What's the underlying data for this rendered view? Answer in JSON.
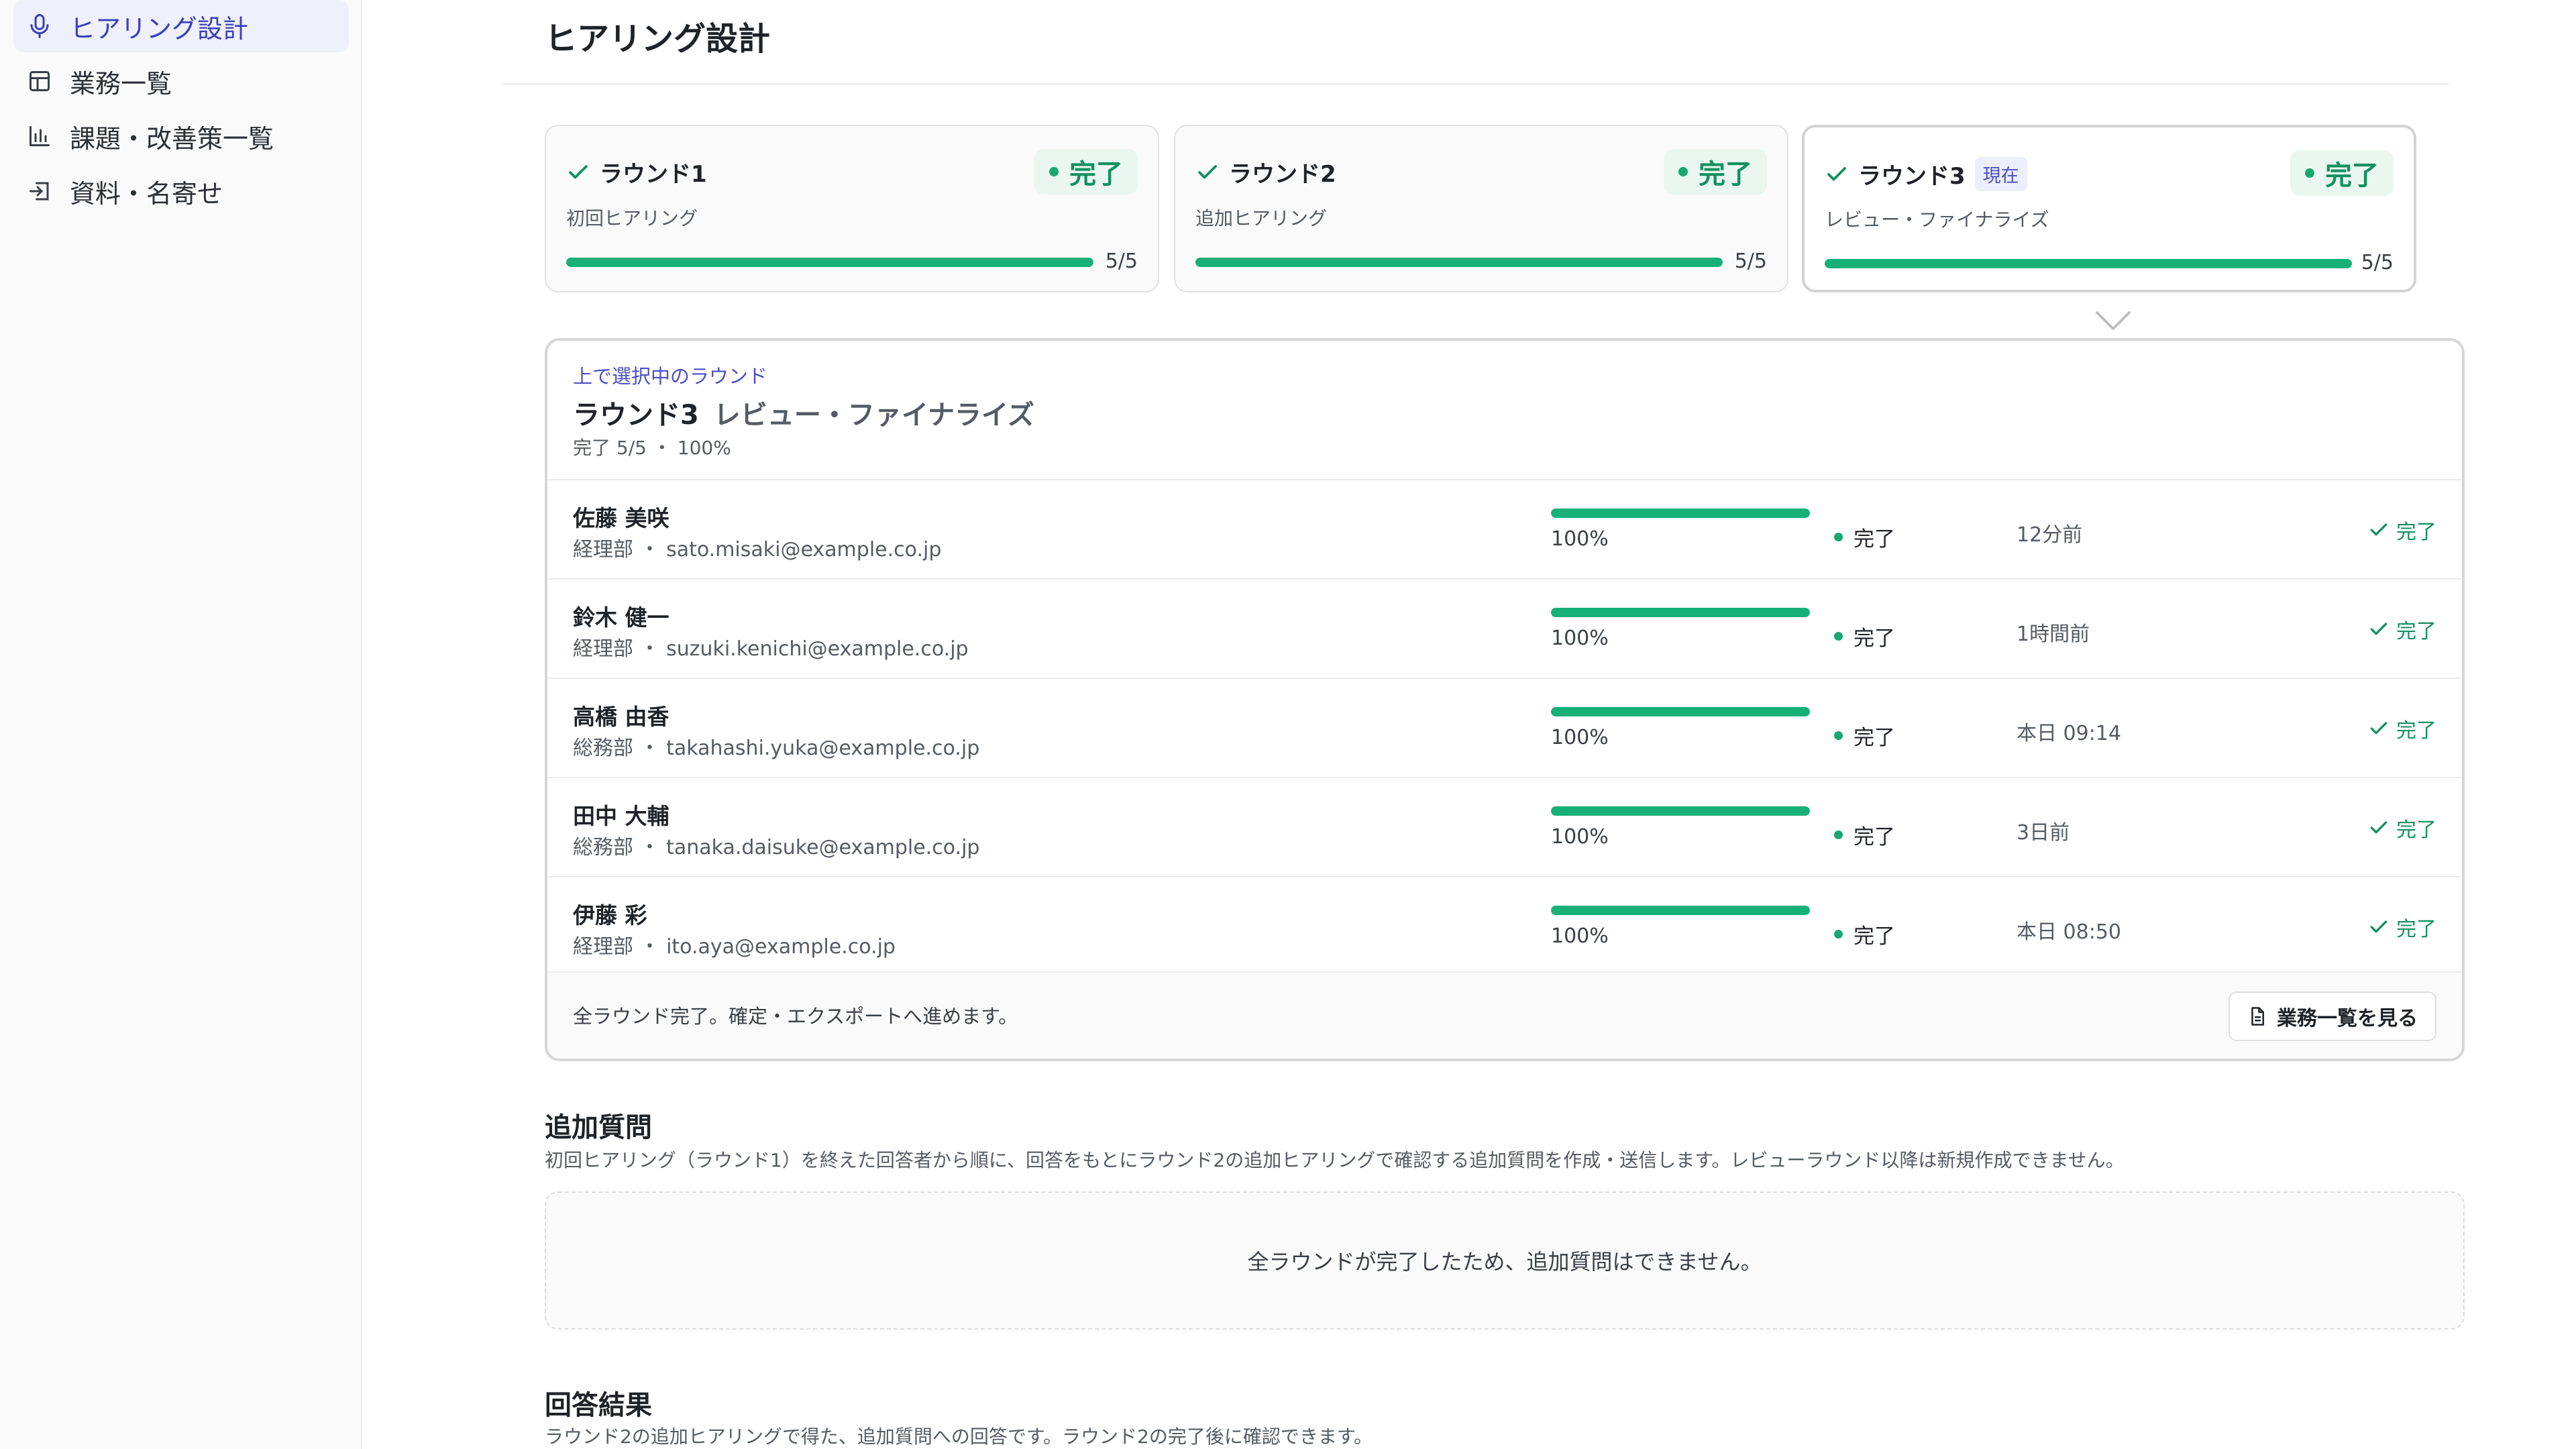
{
  "sidebar": {
    "items": [
      {
        "label": "ヒアリング設計",
        "icon": "microphone-icon",
        "active": true
      },
      {
        "label": "業務一覧",
        "icon": "table-icon",
        "active": false
      },
      {
        "label": "課題・改善策一覧",
        "icon": "bar-chart-icon",
        "active": false
      },
      {
        "label": "資料・名寄せ",
        "icon": "import-icon",
        "active": false
      }
    ]
  },
  "page": {
    "title": "ヒアリング設計"
  },
  "rounds": [
    {
      "label": "ラウンド1",
      "subtitle": "初回ヒアリング",
      "status": "完了",
      "count": "5/5",
      "progress": 1.0,
      "badge": ""
    },
    {
      "label": "ラウンド2",
      "subtitle": "追加ヒアリング",
      "status": "完了",
      "count": "5/5",
      "progress": 1.0,
      "badge": ""
    },
    {
      "label": "ラウンド3",
      "subtitle": "レビュー・ファイナライズ",
      "status": "完了",
      "count": "5/5",
      "progress": 1.0,
      "badge": "現在"
    }
  ],
  "detail": {
    "eyebrow": "上で選択中のラウンド",
    "title": "ラウンド3",
    "title_sub": "レビュー・ファイナライズ",
    "meta": "完了 5/5 ・ 100%",
    "respondents": [
      {
        "name": "佐藤 美咲",
        "sub": "経理部 ・ sato.misaki@example.co.jp",
        "pct": "100%",
        "progress": 1.0,
        "state": "完了",
        "time": "12分前",
        "done": "完了"
      },
      {
        "name": "鈴木 健一",
        "sub": "経理部 ・ suzuki.kenichi@example.co.jp",
        "pct": "100%",
        "progress": 1.0,
        "state": "完了",
        "time": "1時間前",
        "done": "完了"
      },
      {
        "name": "高橋 由香",
        "sub": "総務部 ・ takahashi.yuka@example.co.jp",
        "pct": "100%",
        "progress": 1.0,
        "state": "完了",
        "time": "本日 09:14",
        "done": "完了"
      },
      {
        "name": "田中 大輔",
        "sub": "総務部 ・ tanaka.daisuke@example.co.jp",
        "pct": "100%",
        "progress": 1.0,
        "state": "完了",
        "time": "3日前",
        "done": "完了"
      },
      {
        "name": "伊藤 彩",
        "sub": "経理部 ・ ito.aya@example.co.jp",
        "pct": "100%",
        "progress": 1.0,
        "state": "完了",
        "time": "本日 08:50",
        "done": "完了"
      }
    ],
    "footer_text": "全ラウンド完了。確定・エクスポートへ進めます。",
    "footer_button": "業務一覧を見る"
  },
  "additional": {
    "title": "追加質問",
    "desc": "初回ヒアリング（ラウンド1）を終えた回答者から順に、回答をもとにラウンド2の追加ヒアリングで確認する追加質問を作成・送信します。レビューラウンド以降は新規作成できません。",
    "empty": "全ラウンドが完了したため、追加質問はできません。"
  },
  "results": {
    "title": "回答結果",
    "desc": "ラウンド2の追加ヒアリングで得た、追加質問への回答です。ラウンド2の完了後に確認できます。"
  },
  "colors": {
    "accent": "#3b3fb8",
    "success": "#16b078"
  }
}
